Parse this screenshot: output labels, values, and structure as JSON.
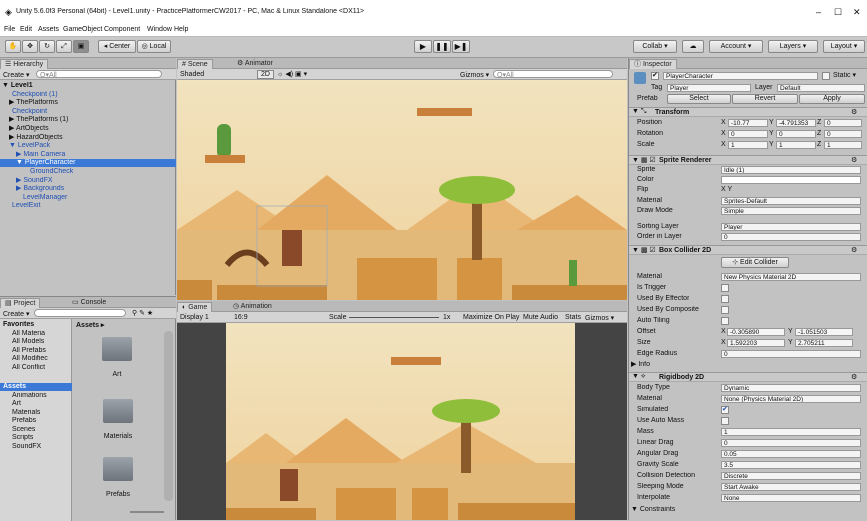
{
  "window": {
    "title": "Unity 5.6.0f3 Personal (64bit) - Level1.unity - PracticePlatformerCW2017 - PC, Mac & Linux Standalone <DX11>",
    "controls": [
      "–",
      "☐",
      "✕"
    ]
  },
  "menu": [
    "File",
    "Edit",
    "Assets",
    "GameObject",
    "Component",
    "Window",
    "Help"
  ],
  "toolbar": {
    "center": "Center",
    "local": "Local",
    "collab": "Collab ▾",
    "account": "Account",
    "layers": "Layers",
    "layout": "Layout"
  },
  "hierarchy": {
    "tab": "Hierarchy",
    "create": "Create ▾",
    "search": "Q▾All",
    "items": [
      {
        "text": "▼ Level1",
        "x": 2,
        "bold": true,
        "blue": false,
        "sel": false
      },
      {
        "text": "Checkpoint (1)",
        "x": 12,
        "blue": true,
        "sel": false
      },
      {
        "text": "▶ ThePlatforms",
        "x": 9,
        "blue": false,
        "sel": false
      },
      {
        "text": "Checkpoint",
        "x": 12,
        "blue": true,
        "sel": false
      },
      {
        "text": "▶ ThePlatforms (1)",
        "x": 9,
        "blue": false,
        "sel": false
      },
      {
        "text": "▶ ArtObjects",
        "x": 9,
        "blue": false,
        "sel": false
      },
      {
        "text": "▶ HazardObjects",
        "x": 9,
        "blue": false,
        "sel": false
      },
      {
        "text": "▼ LevelPack",
        "x": 9,
        "blue": true,
        "sel": false
      },
      {
        "text": "▶ Main Camera",
        "x": 16,
        "blue": true,
        "sel": false
      },
      {
        "text": "▼ PlayerCharacter",
        "x": 16,
        "blue": true,
        "sel": true
      },
      {
        "text": "GroundCheck",
        "x": 30,
        "blue": true,
        "sel": false
      },
      {
        "text": "▶ SoundFX",
        "x": 16,
        "blue": true,
        "sel": false
      },
      {
        "text": "▶ Backgrounds",
        "x": 16,
        "blue": true,
        "sel": false
      },
      {
        "text": "LevelManager",
        "x": 23,
        "blue": true,
        "sel": false
      },
      {
        "text": "LevelExit",
        "x": 12,
        "blue": true,
        "sel": false
      }
    ]
  },
  "scene": {
    "tabs": [
      "Scene",
      "Animator"
    ],
    "shaded": "Shaded",
    "mode2d": "2D",
    "gizmos": "Gizmos ▾",
    "search": "Q▾All"
  },
  "game": {
    "tabs": [
      "Game",
      "Animation"
    ],
    "display": "Display 1",
    "aspect": "16:9",
    "scale": "Scale",
    "scale_val": "1x",
    "buttons": [
      "Maximize On Play",
      "Mute Audio",
      "Stats",
      "Gizmos ▾"
    ]
  },
  "project": {
    "tabs": [
      "Project",
      "Console"
    ],
    "create": "Create ▾",
    "breadcrumb": "Assets ▸",
    "favorites": [
      "Favorites",
      "All Materia",
      "All Models",
      "All Prefabs",
      "All Modifiec",
      "All Conflict"
    ],
    "assets": [
      "Assets",
      "Animations",
      "Art",
      "Materials",
      "Prefabs",
      "Scenes",
      "Scripts",
      "SoundFX"
    ],
    "folders": [
      "Art",
      "Materials",
      "Prefabs"
    ]
  },
  "inspector": {
    "tab": "Inspector",
    "name": "PlayerCharacter",
    "static": "Static ▾",
    "tag_label": "Tag",
    "tag": "Player",
    "layer_label": "Layer",
    "layer": "Default",
    "prefab": "Prefab",
    "prefab_btns": [
      "Select",
      "Revert",
      "Apply"
    ],
    "transform": {
      "title": "Transform",
      "rows": [
        {
          "label": "Position",
          "x": "-10.77",
          "y": "-4.791353",
          "z": "0"
        },
        {
          "label": "Rotation",
          "x": "0",
          "y": "0",
          "z": "0"
        },
        {
          "label": "Scale",
          "x": "1",
          "y": "1",
          "z": "1"
        }
      ]
    },
    "sprite": {
      "title": "Sprite Renderer",
      "sprite_label": "Sprite",
      "sprite": "Idle (1)",
      "color_label": "Color",
      "flip_label": "Flip",
      "flip": "X  Y",
      "material_label": "Material",
      "material": "Sprites-Default",
      "draw_label": "Draw Mode",
      "draw": "Simple",
      "sorting_label": "Sorting Layer",
      "sorting": "Player",
      "order_label": "Order in Layer",
      "order": "0"
    },
    "collider": {
      "title": "Box Collider 2D",
      "edit": "Edit Collider",
      "material_label": "Material",
      "material": "New Physics Material 2D",
      "trigger": "Is Trigger",
      "effector": "Used By Effector",
      "composite": "Used By Composite",
      "autotile": "Auto Tiling",
      "offset_label": "Offset",
      "offset_x": "-0.305890",
      "offset_y": "-1.051503",
      "size_label": "Size",
      "size_x": "1.592203",
      "size_y": "2.705211",
      "edge_label": "Edge Radius",
      "edge": "0",
      "info": "▶ Info"
    },
    "rigidbody": {
      "title": "Rigidbody 2D",
      "rows": [
        {
          "label": "Body Type",
          "value": "Dynamic",
          "kind": "dd"
        },
        {
          "label": "Material",
          "value": "None (Physics Material 2D)",
          "kind": "field"
        },
        {
          "label": "Simulated",
          "value": "✔",
          "kind": "check"
        },
        {
          "label": "Use Auto Mass",
          "value": "",
          "kind": "check"
        },
        {
          "label": "Mass",
          "value": "1",
          "kind": "field"
        },
        {
          "label": "Linear Drag",
          "value": "0",
          "kind": "field"
        },
        {
          "label": "Angular Drag",
          "value": "0.05",
          "kind": "field"
        },
        {
          "label": "Gravity Scale",
          "value": "3.5",
          "kind": "field"
        },
        {
          "label": "Collision Detection",
          "value": "Discrete",
          "kind": "dd"
        },
        {
          "label": "Sleeping Mode",
          "value": "Start Awake",
          "kind": "dd"
        },
        {
          "label": "Interpolate",
          "value": "None",
          "kind": "dd"
        }
      ],
      "constraints": "▼ Constraints"
    }
  }
}
